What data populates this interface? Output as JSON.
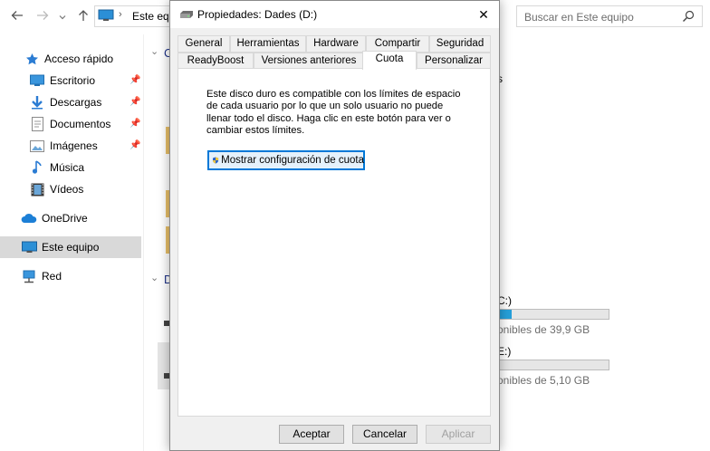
{
  "explorer": {
    "address": {
      "text": "Este equipo"
    },
    "search": {
      "placeholder": "Buscar en Este equipo"
    },
    "nav": {
      "quick_access": "Acceso rápido",
      "desktop": "Escritorio",
      "downloads": "Descargas",
      "documents": "Documentos",
      "pictures": "Imágenes",
      "music": "Música",
      "videos": "Vídeos",
      "onedrive": "OneDrive",
      "this_pc": "Este equipo",
      "network": "Red"
    },
    "content": {
      "folders_header_fragment": "C",
      "devices_header_fragment": "D",
      "side_fragment": "s",
      "drive_c": {
        "label_fragment": "C:)",
        "free_text": "onibles de 39,9 GB",
        "used_fraction": 0.12
      },
      "drive_e": {
        "label_fragment": "E:)",
        "free_text": "onibles de 5,10 GB",
        "used_fraction": 0.0
      }
    }
  },
  "dialog": {
    "title": "Propiedades: Dades (D:)",
    "close": "✕",
    "tabs_row1": [
      "General",
      "Herramientas",
      "Hardware",
      "Compartir",
      "Seguridad"
    ],
    "tabs_row2": [
      "ReadyBoost",
      "Versiones anteriores",
      "Cuota",
      "Personalizar"
    ],
    "active_tab": "Cuota",
    "description": "Este disco duro es compatible con los límites de espacio de cada usuario por lo que un solo usuario no puede llenar todo el disco. Haga clic en este botón para ver o cambiar estos límites.",
    "quota_button": "Mostrar configuración de cuota",
    "buttons": {
      "ok": "Aceptar",
      "cancel": "Cancelar",
      "apply": "Aplicar"
    }
  },
  "colors": {
    "accent": "#0078d7",
    "selected_bg": "#d9d9d9",
    "bar_fill": "#26a0da"
  }
}
